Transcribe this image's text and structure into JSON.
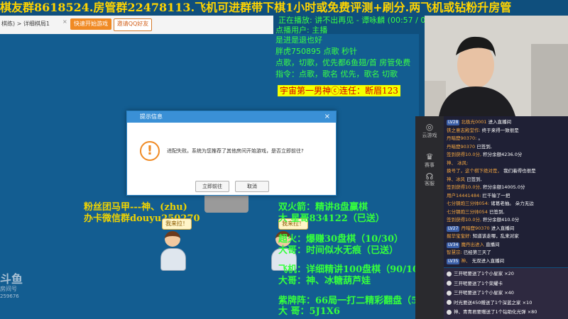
{
  "marquee": {
    "text": "棋友群8618524.房管群22478113.飞机可进群带下棋1小时或免费评测+刷分.两飞机或钻粉升房管"
  },
  "client": {
    "breadcrumb": "棋练) > 详细棋局1",
    "close_glyph": "×",
    "quick_start_label": "快速开始游戏",
    "invite_label": "邀请QQ好友"
  },
  "dialog": {
    "title": "提示信息",
    "close_glyph": "×",
    "warn_glyph": "!",
    "message": "进配失败。系统为您推荐了其他房间开始游戏，是否立即前往?",
    "go_label": "立即前往",
    "cancel_label": "取消"
  },
  "now_playing": {
    "line1": "正在播放: 讲不出再见 - 谭咏麟 (00:57 / 04:52)",
    "line2": "点播用户: 主播",
    "line3": "是进是退也好",
    "line4": "胖虎750895 点歌 秒针",
    "line5": "点歌，切歌，优先都6鱼翅/首  房管免费",
    "line6": "指令：点歌，歌名      优先，歌名    切歌"
  },
  "badge": {
    "text": "宇宙第一男神ⓒ连任：断眉123"
  },
  "left_overlay": {
    "line1": "粉丝团马甲---神、(zhu)",
    "line2": "办卡微信群douyu250270"
  },
  "players": {
    "bubble_left": "我来拉！",
    "bubble_right": "我来拉！"
  },
  "tasks": {
    "l1": "双火箭：精讲8盘赢棋",
    "l2": "大      星哥834122（已送）",
    "l3": "超火：爆赚30盘棋（10/30）",
    "l4": "大哥：时间似水无痕（已送）",
    "l5": "飞机：详细精讲100盘棋（90/100）",
    "l6": "大哥：神、冰糖葫芦娃",
    "l7": "紫牌阵：66局一打二精彩翻盘（5/66）",
    "l8": "大      哥：5J1X6"
  },
  "sidebar": {
    "item1": "云游戏",
    "item2": "赛事",
    "item3": "客服"
  },
  "chat": [
    {
      "level": "LV28",
      "name": "北极光0001",
      "text": "进入直播间"
    },
    {
      "level": "",
      "name": "铁之意志殿堂作:",
      "text": "终于来得一致很是"
    },
    {
      "level": "",
      "name": "丹暗窟90370:",
      "text": "。"
    },
    {
      "level": "",
      "name": "丹暗窟90370",
      "text": "已签到,"
    },
    {
      "level": "",
      "name": "签到获得10.0分,",
      "text": "积分余额4236.0分"
    },
    {
      "level": "",
      "name": "神、 冰风:",
      "text": ""
    },
    {
      "level": "",
      "name": "换号了，这个棋下绝对是，",
      "text": "我们着得也很是"
    },
    {
      "level": "",
      "name": "神、冰风",
      "text": "已签到,"
    },
    {
      "level": "",
      "name": "签到获得10.0分,",
      "text": "积分余额14005.0分"
    },
    {
      "level": "",
      "name": "用户14441484:",
      "text": "拦千输了一把"
    },
    {
      "level": "",
      "name": "七分钢炮三分帅054:",
      "text": "诸葛老抽。 朵力无边"
    },
    {
      "level": "",
      "name": "七分钢炮三分帅054",
      "text": "已签到,"
    },
    {
      "level": "",
      "name": "签到获得10.0分,",
      "text": "积分余额410.0分"
    },
    {
      "level": "LV27",
      "name": "丹暗窟90370",
      "text": "进入直播间"
    },
    {
      "level": "",
      "name": "掘华宝宝好:",
      "text": "知道该走哪，乱来对家"
    },
    {
      "level": "LV34",
      "name": "魔丹出进入",
      "text": "直播间"
    },
    {
      "level": "",
      "name": "智慧宗:",
      "text": "已经第三天了"
    },
    {
      "level": "LV35",
      "name": "神、",
      "text": "无双进入直播间"
    }
  ],
  "gifts": [
    {
      "text": "三开呢要送了1个小星家 ×20"
    },
    {
      "text": "三开呢要送了1个荣耀卡"
    },
    {
      "text": "三开呢要送了1个小星家 ×40"
    },
    {
      "text": "时光要送450赠送了1个深蓝之家 ×10"
    },
    {
      "text": "神、青青君要赠送了1个钻助化光弹 ×80"
    }
  ],
  "logo": {
    "name": "斗鱼",
    "sub": "房间号",
    "room": "259676"
  },
  "colors": {
    "marquee": "#ffd400",
    "overlay_green": "#35ff3d",
    "overlay_yellow": "#f1d400",
    "dialog_header": "#3a90d6",
    "accent_orange": "#f08a24"
  }
}
